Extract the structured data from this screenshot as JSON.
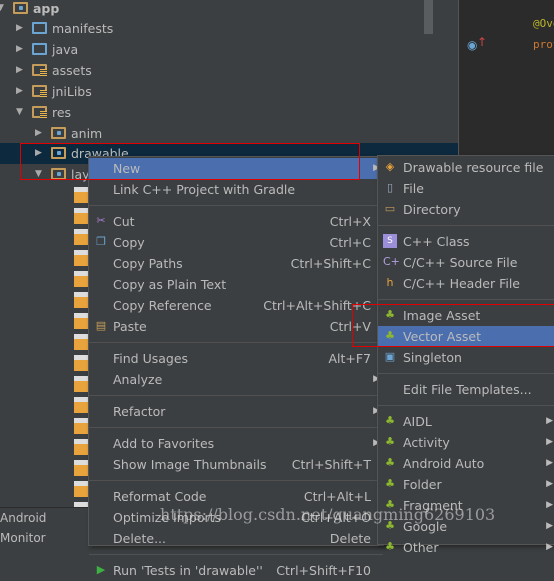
{
  "tree": [
    {
      "label": "app",
      "depth": 0,
      "expanded": true,
      "icon": "module-folder-icon"
    },
    {
      "label": "manifests",
      "depth": 1,
      "expanded": false,
      "icon": "folder-icon"
    },
    {
      "label": "java",
      "depth": 1,
      "expanded": false,
      "icon": "folder-icon"
    },
    {
      "label": "assets",
      "depth": 1,
      "expanded": false,
      "icon": "resource-folder-icon"
    },
    {
      "label": "jniLibs",
      "depth": 1,
      "expanded": false,
      "icon": "resource-folder-icon"
    },
    {
      "label": "res",
      "depth": 1,
      "expanded": true,
      "icon": "resource-folder-icon"
    },
    {
      "label": "anim",
      "depth": 2,
      "expanded": false,
      "icon": "package-folder-icon"
    },
    {
      "label": "drawable",
      "depth": 2,
      "expanded": false,
      "icon": "package-folder-icon",
      "selected": true
    },
    {
      "label": "layout",
      "depth": 2,
      "expanded": true,
      "icon": "package-folder-icon"
    }
  ],
  "editor": {
    "line1": "@Ove",
    "line2": "prot"
  },
  "bottom_tab": "Android Monitor",
  "watermark": "https://blog.csdn.net/guangming6269103",
  "context_menu": [
    {
      "label": "New",
      "submenu": true,
      "highlighted": true
    },
    {
      "label": "Link C++ Project with Gradle"
    },
    {
      "sep": true
    },
    {
      "label": "Cut",
      "shortcut": "Ctrl+X",
      "icon": "scissors-icon"
    },
    {
      "label": "Copy",
      "shortcut": "Ctrl+C",
      "icon": "copy-icon"
    },
    {
      "label": "Copy Paths",
      "shortcut": "Ctrl+Shift+C"
    },
    {
      "label": "Copy as Plain Text"
    },
    {
      "label": "Copy Reference",
      "shortcut": "Ctrl+Alt+Shift+C"
    },
    {
      "label": "Paste",
      "shortcut": "Ctrl+V",
      "icon": "paste-icon"
    },
    {
      "sep": true
    },
    {
      "label": "Find Usages",
      "shortcut": "Alt+F7"
    },
    {
      "label": "Analyze",
      "submenu": true
    },
    {
      "sep": true
    },
    {
      "label": "Refactor",
      "submenu": true
    },
    {
      "sep": true
    },
    {
      "label": "Add to Favorites",
      "submenu": true
    },
    {
      "label": "Show Image Thumbnails",
      "shortcut": "Ctrl+Shift+T"
    },
    {
      "sep": true
    },
    {
      "label": "Reformat Code",
      "shortcut": "Ctrl+Alt+L"
    },
    {
      "label": "Optimize Imports",
      "shortcut": "Ctrl+Alt+O"
    },
    {
      "label": "Delete...",
      "shortcut": "Delete"
    },
    {
      "sep": true
    },
    {
      "label": "Run 'Tests in 'drawable''",
      "shortcut": "Ctrl+Shift+F10",
      "icon": "run-icon"
    }
  ],
  "new_submenu": [
    {
      "label": "Drawable resource file",
      "icon": "xml-file-icon"
    },
    {
      "label": "File",
      "icon": "file-icon"
    },
    {
      "label": "Directory",
      "icon": "folder-icon"
    },
    {
      "sep": true
    },
    {
      "label": "C++ Class",
      "icon": "cpp-class-icon"
    },
    {
      "label": "C/C++ Source File",
      "icon": "cpp-source-icon"
    },
    {
      "label": "C/C++ Header File",
      "icon": "header-file-icon"
    },
    {
      "sep": true
    },
    {
      "label": "Image Asset",
      "icon": "android-icon"
    },
    {
      "label": "Vector Asset",
      "icon": "android-icon",
      "highlighted": true
    },
    {
      "label": "Singleton",
      "icon": "singleton-icon"
    },
    {
      "sep": true
    },
    {
      "label": "Edit File Templates..."
    },
    {
      "sep": true
    },
    {
      "label": "AIDL",
      "icon": "android-icon",
      "submenu": true
    },
    {
      "label": "Activity",
      "icon": "android-icon",
      "submenu": true
    },
    {
      "label": "Android Auto",
      "icon": "android-icon",
      "submenu": true
    },
    {
      "label": "Folder",
      "icon": "android-icon",
      "submenu": true
    },
    {
      "label": "Fragment",
      "icon": "android-icon",
      "submenu": true
    },
    {
      "label": "Google",
      "icon": "android-icon",
      "submenu": true
    },
    {
      "label": "Other",
      "icon": "android-icon",
      "submenu": true
    }
  ],
  "colors": {
    "highlight": "#4b6eaf",
    "selection": "#0d293e",
    "annotation": "#e00000",
    "android": "#8cb72f"
  }
}
